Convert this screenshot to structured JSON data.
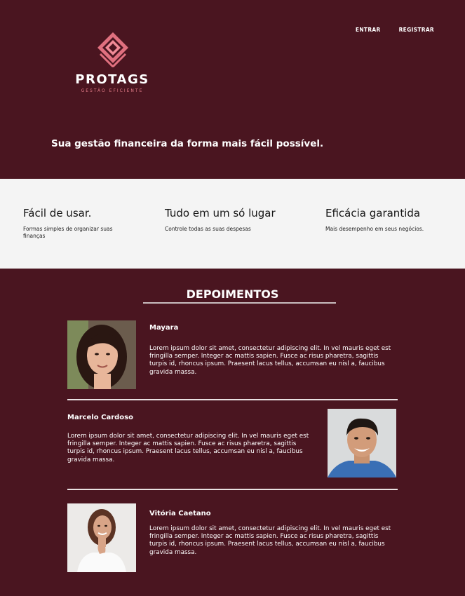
{
  "nav": {
    "login": "ENTRAR",
    "register": "REGISTRAR"
  },
  "logo": {
    "name": "PROTAGS",
    "tagline": "GESTÃO EFICIENTE",
    "icon": "diamond-logo-icon"
  },
  "hero": {
    "headline": "Sua gestão financeira da forma mais fácil possível."
  },
  "features": [
    {
      "title": "Fácil de usar.",
      "text": "Formas simples de organizar suas finanças"
    },
    {
      "title": "Tudo em um só lugar",
      "text": "Controle todas as suas despesas"
    },
    {
      "title": "Eficácia garantida",
      "text": "Mais desempenho em seus negócios."
    }
  ],
  "testimonials": {
    "title": "DEPOIMENTOS",
    "items": [
      {
        "name": "Mayara",
        "text": "Lorem ipsum dolor sit amet, consectetur adipiscing elit. In vel mauris eget est fringilla semper. Integer ac mattis sapien. Fusce ac risus pharetra, sagittis turpis id, rhoncus ipsum. Praesent lacus tellus, accumsan eu nisl a, faucibus gravida massa."
      },
      {
        "name": "Marcelo Cardoso",
        "text": "Lorem ipsum dolor sit amet, consectetur adipiscing elit. In vel mauris eget est fringilla semper. Integer ac mattis sapien. Fusce ac risus pharetra, sagittis turpis id, rhoncus ipsum. Praesent lacus tellus, accumsan eu nisl a, faucibus gravida massa."
      },
      {
        "name": "Vitória Caetano",
        "text": "Lorem ipsum dolor sit amet, consectetur adipiscing elit. In vel mauris eget est fringilla semper. Integer ac mattis sapien. Fusce ac risus pharetra, sagittis turpis id, rhoncus ipsum. Praesent lacus tellus, accumsan eu nisl a, faucibus gravida massa."
      }
    ]
  },
  "colors": {
    "background": "#4a1520",
    "features_bg": "#f4f4f4",
    "accent": "#e07a86"
  }
}
